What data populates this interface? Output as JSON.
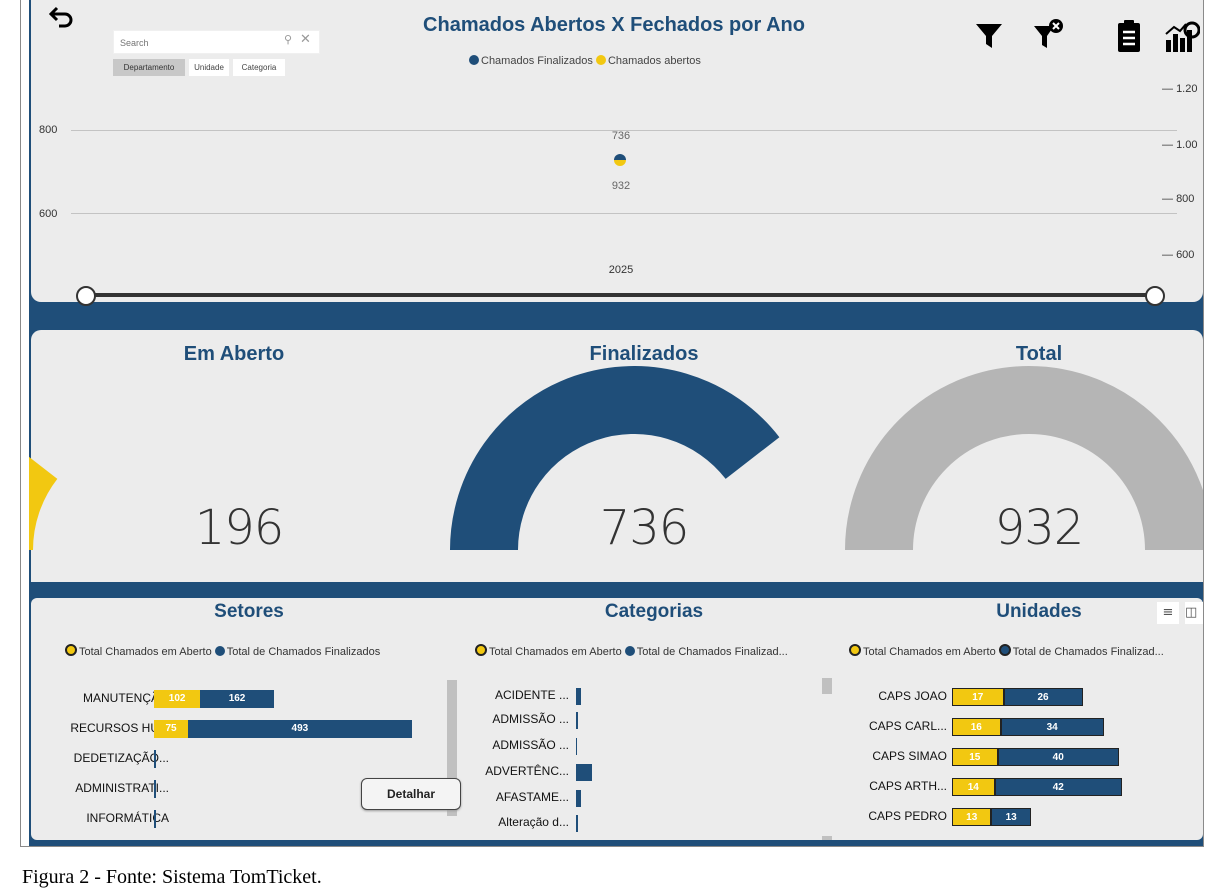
{
  "header": {
    "title": "Chamados Abertos X Fechados por Ano",
    "legend": [
      {
        "label": "Chamados Finalizados",
        "color": "#1f4e79"
      },
      {
        "label": "Chamados abertos",
        "color": "#f2c811"
      }
    ],
    "tools": [
      "filter-icon",
      "clear-filter-icon",
      "report-icon",
      "analytics-icon"
    ],
    "back_icon": "undo-arrow-icon"
  },
  "slicer": {
    "search_placeholder": "Search",
    "tabs": [
      "Departamento",
      "Unidade",
      "Categoria"
    ],
    "selected_tab": "Departamento"
  },
  "chart_data": {
    "type": "scatter",
    "x": [
      "2025"
    ],
    "series": [
      {
        "name": "Chamados Finalizados",
        "values": [
          736
        ],
        "color": "#1f4e79"
      },
      {
        "name": "Chamados abertos",
        "values": [
          932
        ],
        "color": "#f2c811"
      }
    ],
    "data_labels": [
      "736",
      "932"
    ],
    "y_left_ticks": [
      "800",
      "600"
    ],
    "y_right_ticks": [
      "1.20",
      "1.00",
      "800",
      "600"
    ],
    "x_label": "2025"
  },
  "kpis": [
    {
      "title": "Em Aberto",
      "value": "196",
      "fraction": 0.21,
      "color": "#f2c811"
    },
    {
      "title": "Finalizados",
      "value": "736",
      "fraction": 0.79,
      "color": "#1f4e79"
    },
    {
      "title": "Total",
      "value": "932",
      "fraction": 1.0,
      "color": "#b5b5b5"
    }
  ],
  "setores": {
    "title": "Setores",
    "legend": [
      "Total Chamados em Aberto",
      "Total de Chamados Finalizados"
    ],
    "rows": [
      {
        "label": "MANUTENÇÃ...",
        "aberto": 102,
        "finalizado": 162,
        "aberto_label": "102",
        "finalizado_label": "162"
      },
      {
        "label": "RECURSOS HU...",
        "aberto": 75,
        "finalizado": 493,
        "aberto_label": "75",
        "finalizado_label": "493"
      },
      {
        "label": "DEDETIZAÇÃO...",
        "aberto": 1,
        "finalizado": 3,
        "aberto_label": "",
        "finalizado_label": ""
      },
      {
        "label": "ADMINISTRATI...",
        "aberto": 0,
        "finalizado": 3,
        "aberto_label": "",
        "finalizado_label": ""
      },
      {
        "label": "INFORMÁTICA",
        "aberto": 0,
        "finalizado": 1,
        "aberto_label": "",
        "finalizado_label": ""
      }
    ],
    "button": "Detalhar"
  },
  "categorias": {
    "title": "Categorias",
    "legend": [
      "Total Chamados em Aberto",
      "Total de Chamados Finalizad..."
    ],
    "rows": [
      {
        "label": "ACIDENTE ...",
        "finalizado": 3
      },
      {
        "label": "ADMISSÃO ...",
        "finalizado": 1
      },
      {
        "label": "ADMISSÃO ...",
        "finalizado": 0.5
      },
      {
        "label": "ADVERTÊNC...",
        "finalizado": 10
      },
      {
        "label": "AFASTAME...",
        "finalizado": 3
      },
      {
        "label": "Alteração d...",
        "finalizado": 1
      }
    ]
  },
  "unidades": {
    "title": "Unidades",
    "legend": [
      "Total Chamados em Aberto",
      "Total de Chamados Finalizad..."
    ],
    "rows": [
      {
        "label": "CAPS JOAO",
        "aberto": 17,
        "finalizado": 26,
        "aberto_label": "17",
        "finalizado_label": "26"
      },
      {
        "label": "CAPS CARL...",
        "aberto": 16,
        "finalizado": 34,
        "aberto_label": "16",
        "finalizado_label": "34"
      },
      {
        "label": "CAPS SIMAO",
        "aberto": 15,
        "finalizado": 40,
        "aberto_label": "15",
        "finalizado_label": "40"
      },
      {
        "label": "CAPS ARTH...",
        "aberto": 14,
        "finalizado": 42,
        "aberto_label": "14",
        "finalizado_label": "42"
      },
      {
        "label": "CAPS PEDRO",
        "aberto": 13,
        "finalizado": 13,
        "aberto_label": "13",
        "finalizado_label": "13"
      }
    ]
  },
  "caption": "Figura 2 - Fonte:  Sistema TomTicket."
}
